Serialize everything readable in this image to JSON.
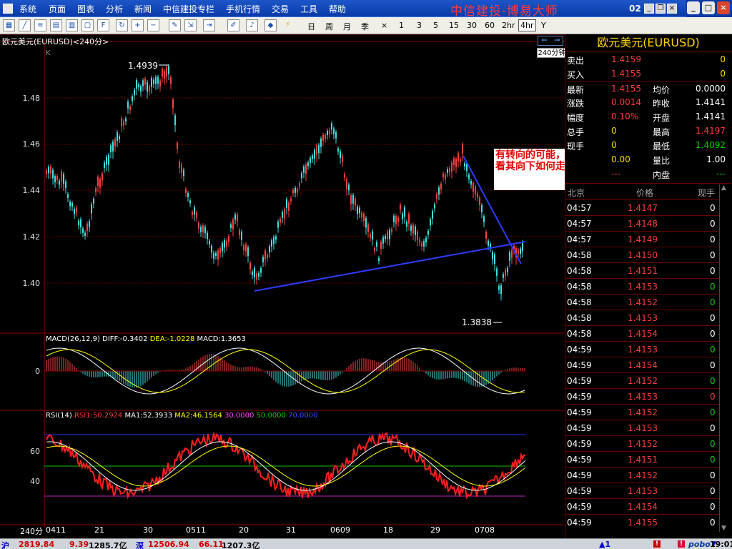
{
  "menu": [
    "系统",
    "页面",
    "图表",
    "分析",
    "新闻",
    "中信建投专栏",
    "手机行情",
    "交易",
    "工具",
    "帮助"
  ],
  "app_title": "中信建投-博易大师",
  "window_number": "02",
  "toolbar": {
    "periods": [
      "日",
      "周",
      "月",
      "季",
      "×",
      "1",
      "3",
      "5",
      "15",
      "30",
      "60",
      "2hr",
      "4hr",
      "Y"
    ],
    "active_period": "4hr"
  },
  "chart": {
    "instrument_title": "欧元美元(EURUSD)<240分>",
    "k_label": "K",
    "period_tag": "240分钟",
    "price_axis": [
      "1.48",
      "1.46",
      "1.44",
      "1.42",
      "1.40"
    ],
    "macd_axis": [
      "0"
    ],
    "rsi_axis": [
      "60",
      "40"
    ],
    "x_axis_prefix": "240分",
    "x_axis": [
      "0411",
      "21",
      "30",
      "0511",
      "20",
      "31",
      "0609",
      "18",
      "29",
      "0708"
    ],
    "high_label": "1.4939",
    "low_label": "1.3838",
    "macd_label": {
      "name": "MACD(26,12,9)",
      "diff": "DIFF:-0.3402",
      "dea": "DEA:-1.0228",
      "macd": "MACD:1.3653"
    },
    "rsi_label": {
      "name": "RSI(14)",
      "rsi1": "RSI1:50.2924",
      "ma1": "MA1:52.3933",
      "ma2": "MA2:46.1564",
      "l30": "30.0000",
      "l50": "50.0000",
      "l70": "70.0000"
    },
    "annotation": "有转向的可能，当然要看其向下如何走。"
  },
  "quote": {
    "title": "欧元美元(EURUSD)",
    "rows": [
      {
        "l1": "卖出",
        "v1": "1.4159",
        "c1": "red",
        "l2": "",
        "v2": "0",
        "c2": "gold"
      },
      {
        "l1": "买入",
        "v1": "1.4155",
        "c1": "red",
        "l2": "",
        "v2": "0",
        "c2": "gold"
      },
      {
        "l1": "最新",
        "v1": "1.4155",
        "c1": "red",
        "l2": "均价",
        "v2": "0.0000",
        "c2": "white"
      },
      {
        "l1": "涨跌",
        "v1": "0.0014",
        "c1": "red",
        "l2": "昨收",
        "v2": "1.4141",
        "c2": "white"
      },
      {
        "l1": "幅度",
        "v1": "0.10%",
        "c1": "red",
        "l2": "开盘",
        "v2": "1.4141",
        "c2": "white"
      },
      {
        "l1": "总手",
        "v1": "0",
        "c1": "gold",
        "l2": "最高",
        "v2": "1.4197",
        "c2": "red"
      },
      {
        "l1": "现手",
        "v1": "0",
        "c1": "gold",
        "l2": "最低",
        "v2": "1.4092",
        "c2": "green"
      },
      {
        "l1": "",
        "v1": "0.00",
        "c1": "gold",
        "l2": "量比",
        "v2": "1.00",
        "c2": "white"
      },
      {
        "l1": "",
        "v1": "---",
        "c1": "red",
        "l2": "内盘",
        "v2": "---",
        "c2": "green"
      }
    ],
    "tick_headers": {
      "time": "北京",
      "price": "价格",
      "vol": "现手"
    },
    "ticks": [
      {
        "time": "04:57",
        "price": "1.4147",
        "vol": "0",
        "vc": "white"
      },
      {
        "time": "04:57",
        "price": "1.4148",
        "vol": "0",
        "vc": "white"
      },
      {
        "time": "04:57",
        "price": "1.4149",
        "vol": "0",
        "vc": "white"
      },
      {
        "time": "04:58",
        "price": "1.4150",
        "vol": "0",
        "vc": "white"
      },
      {
        "time": "04:58",
        "price": "1.4151",
        "vol": "0",
        "vc": "white"
      },
      {
        "time": "04:58",
        "price": "1.4153",
        "vol": "0",
        "vc": "green"
      },
      {
        "time": "04:58",
        "price": "1.4152",
        "vol": "0",
        "vc": "green"
      },
      {
        "time": "04:58",
        "price": "1.4153",
        "vol": "0",
        "vc": "white"
      },
      {
        "time": "04:58",
        "price": "1.4154",
        "vol": "0",
        "vc": "white"
      },
      {
        "time": "04:59",
        "price": "1.4153",
        "vol": "0",
        "vc": "green"
      },
      {
        "time": "04:59",
        "price": "1.4154",
        "vol": "0",
        "vc": "white"
      },
      {
        "time": "04:59",
        "price": "1.4152",
        "vol": "0",
        "vc": "green"
      },
      {
        "time": "04:59",
        "price": "1.4153",
        "vol": "0",
        "vc": "red"
      },
      {
        "time": "04:59",
        "price": "1.4152",
        "vol": "0",
        "vc": "green"
      },
      {
        "time": "04:59",
        "price": "1.4153",
        "vol": "0",
        "vc": "white"
      },
      {
        "time": "04:59",
        "price": "1.4152",
        "vol": "0",
        "vc": "green"
      },
      {
        "time": "04:59",
        "price": "1.4151",
        "vol": "0",
        "vc": "green"
      },
      {
        "time": "04:59",
        "price": "1.4152",
        "vol": "0",
        "vc": "white"
      },
      {
        "time": "04:59",
        "price": "1.4153",
        "vol": "0",
        "vc": "white"
      },
      {
        "time": "04:59",
        "price": "1.4154",
        "vol": "0",
        "vc": "white"
      },
      {
        "time": "04:59",
        "price": "1.4155",
        "vol": "0",
        "vc": "white"
      }
    ]
  },
  "status": {
    "sh_label": "沪",
    "sh_index": "2819.84",
    "sh_change": "9.39",
    "sh_amount": "1285.7亿",
    "sz_label": "深",
    "sz_index": "12506.94",
    "sz_change": "66.11",
    "sz_amount": "1207.3亿",
    "alert": "▲1",
    "brand": "pobo",
    "time": "19:01"
  }
}
